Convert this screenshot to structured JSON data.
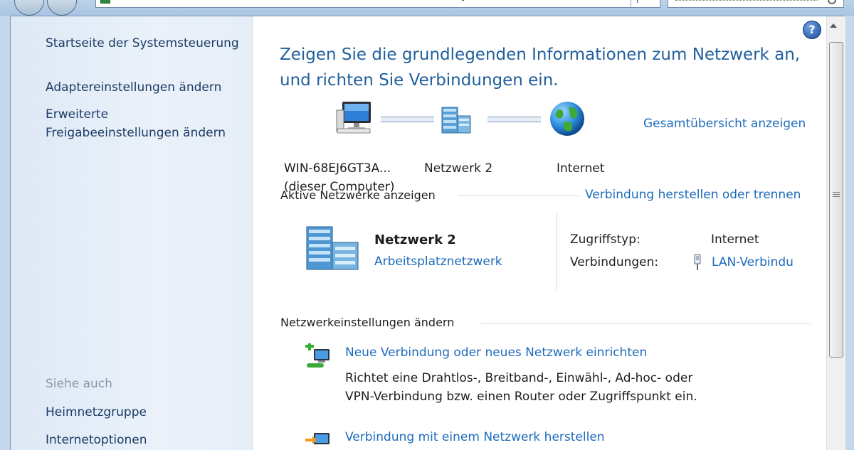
{
  "sidebar": {
    "home_label": "Startseite der Systemsteuerung",
    "adapter_label": "Adaptereinstellungen ändern",
    "sharing_label_line1": "Erweiterte",
    "sharing_label_line2": "Freigabeeinstellungen ändern",
    "see_also_label": "Siehe auch",
    "homegroup_label": "Heimnetzgruppe",
    "internet_options_label": "Internetoptionen"
  },
  "main": {
    "help_label": "?",
    "title_line1": "Zeigen Sie die grundlegenden Informationen zum Netzwerk an,",
    "title_line2": "und richten Sie Verbindungen ein.",
    "full_map_link": "Gesamtübersicht anzeigen",
    "map": {
      "computer_name": "WIN-68EJ6GT3A...",
      "computer_sub": "(dieser Computer)",
      "network_name": "Netzwerk  2",
      "internet_label": "Internet"
    },
    "active_networks_heading": "Aktive Netzwerke anzeigen",
    "connect_disconnect_link": "Verbindung herstellen oder trennen",
    "network": {
      "name": "Netzwerk  2",
      "type_link": "Arbeitsplatznetzwerk",
      "access_label": "Zugriffstyp:",
      "access_value": "Internet",
      "connections_label": "Verbindungen:",
      "connections_link": "LAN-Verbindu"
    },
    "change_settings_heading": "Netzwerkeinstellungen ändern",
    "tasks": [
      {
        "title": "Neue Verbindung oder neues Netzwerk einrichten",
        "desc_line1": "Richtet eine Drahtlos-, Breitband-, Einwähl-, Ad-hoc- oder",
        "desc_line2": "VPN-Verbindung bzw. einen Router oder Zugriffspunkt ein."
      },
      {
        "title": "Verbindung mit einem Netzwerk herstellen"
      }
    ]
  },
  "icons": {
    "computer": "computer-icon",
    "network": "network-building-icon",
    "internet": "globe-icon",
    "lan": "lan-plug-icon",
    "new_connection": "new-connection-icon",
    "connect": "connect-network-icon"
  },
  "colors": {
    "title": "#1f5f9c",
    "link": "#1d6bbb",
    "sidebar_link": "#1c3b66",
    "sidebar_bg": "#dde9f6"
  }
}
